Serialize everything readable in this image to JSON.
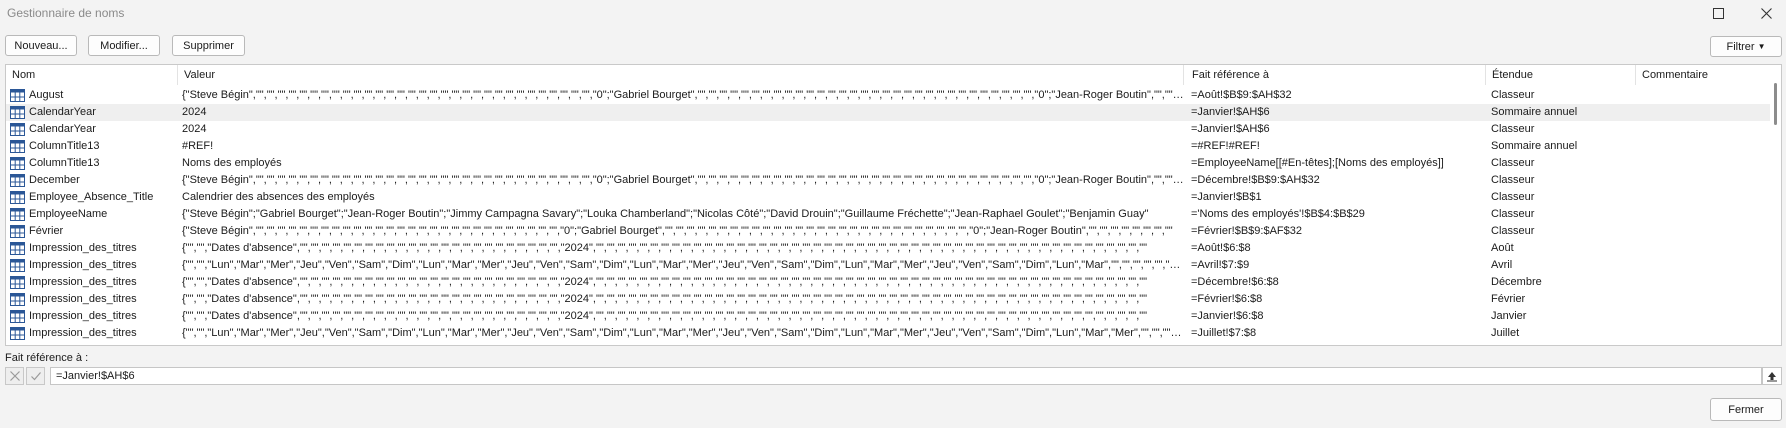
{
  "window": {
    "title": "Gestionnaire de noms"
  },
  "toolbar": {
    "new_label": "Nouveau...",
    "edit_label": "Modifier...",
    "delete_label": "Supprimer",
    "filter_label": "Filtrer"
  },
  "table": {
    "headers": {
      "name": "Nom",
      "value": "Valeur",
      "refers_to": "Fait référence à",
      "scope": "Étendue",
      "comment": "Commentaire"
    },
    "rows": [
      {
        "name": "August",
        "value": "{\"Steve Bégin\",\"\",\"\",\"\",\"\",\"\",\"\",\"\",\"\",\"\",\"\",\"\",\"\",\"\",\"\",\"\",\"\",\"\",\"\",\"\",\"\",\"\",\"\",\"\",\"\",\"\",\"\",\"\",\"\",\"\",\"\",\"\",\"0\";\"Gabriel Bourget\",\"\",\"\",\"\",\"\",\"\",\"\",\"\",\"\",\"\",\"\",\"\",\"\",\"\",\"\",\"\",\"\",\"\",\"\",\"\",\"\",\"\",\"\",\"\",\"\",\"\",\"\",\"\",\"\",\"\",\"\",\"\",\"0\";\"Jean-Roger Boutin\",\"\",\"\",\"\",\"\",\"\",\"\",\"\"",
        "refers_to": "=Août!$B$9:$AH$32",
        "scope": "Classeur",
        "comment": ""
      },
      {
        "name": "CalendarYear",
        "value": "2024",
        "refers_to": "=Janvier!$AH$6",
        "scope": "Sommaire annuel",
        "comment": ""
      },
      {
        "name": "CalendarYear",
        "value": "2024",
        "refers_to": "=Janvier!$AH$6",
        "scope": "Classeur",
        "comment": ""
      },
      {
        "name": "ColumnTitle13",
        "value": "#REF!",
        "refers_to": "=#REF!#REF!",
        "scope": "Sommaire annuel",
        "comment": ""
      },
      {
        "name": "ColumnTitle13",
        "value": "Noms des employés",
        "refers_to": "=EmployeeName[[#En-têtes];[Noms des employés]]",
        "scope": "Classeur",
        "comment": ""
      },
      {
        "name": "December",
        "value": "{\"Steve Bégin\",\"\",\"\",\"\",\"\",\"\",\"\",\"\",\"\",\"\",\"\",\"\",\"\",\"\",\"\",\"\",\"\",\"\",\"\",\"\",\"\",\"\",\"\",\"\",\"\",\"\",\"\",\"\",\"\",\"\",\"\",\"\",\"0\";\"Gabriel Bourget\",\"\",\"\",\"\",\"\",\"\",\"\",\"\",\"\",\"\",\"\",\"\",\"\",\"\",\"\",\"\",\"\",\"\",\"\",\"\",\"\",\"\",\"\",\"\",\"\",\"\",\"\",\"\",\"\",\"\",\"\",\"\",\"0\";\"Jean-Roger Boutin\",\"\",\"\",\"\",\"\",\"\",\"\",\"\"",
        "refers_to": "=Décembre!$B$9:$AH$32",
        "scope": "Classeur",
        "comment": ""
      },
      {
        "name": "Employee_Absence_Title",
        "value": "Calendrier des absences des employés",
        "refers_to": "=Janvier!$B$1",
        "scope": "Classeur",
        "comment": ""
      },
      {
        "name": "EmployeeName",
        "value": "{\"Steve Bégin\";\"Gabriel Bourget\";\"Jean-Roger Boutin\";\"Jimmy Campagna Savary\";\"Louka Chamberland\";\"Nicolas Côté\";\"David Drouin\";\"Guillaume Fréchette\";\"Jean-Raphael Goulet\";\"Benjamin Guay\"",
        "refers_to": "='Noms des employés'!$B$4:$B$29",
        "scope": "Classeur",
        "comment": ""
      },
      {
        "name": "Février",
        "value": "{\"Steve Bégin\",\"\",\"\",\"\",\"\",\"\",\"\",\"\",\"\",\"\",\"\",\"\",\"\",\"\",\"\",\"\",\"\",\"\",\"\",\"\",\"\",\"\",\"\",\"\",\"\",\"\",\"\",\"\",\"\",\"0\";\"Gabriel Bourget\",\"\",\"\",\"\",\"\",\"\",\"\",\"\",\"\",\"\",\"\",\"\",\"\",\"\",\"\",\"\",\"\",\"\",\"\",\"\",\"\",\"\",\"\",\"\",\"\",\"\",\"\",\"\",\"\",\"0\";\"Jean-Roger Boutin\",\"\",\"\",\"\",\"\",\"\",\"\",\"\",\"\"",
        "refers_to": "=Février!$B$9:$AF$32",
        "scope": "Classeur",
        "comment": ""
      },
      {
        "name": "Impression_des_titres",
        "value": "{\"\",\"\",\"Dates d'absence\",\"\",\"\",\"\",\"\",\"\",\"\",\"\",\"\",\"\",\"\",\"\",\"\",\"\",\"\",\"\",\"\",\"\",\"\",\"\",\"\",\"\",\"\",\"\",\"\",\"2024\",\"\",\"\",\"\",\"\",\"\",\"\",\"\",\"\",\"\",\"\",\"\",\"\",\"\",\"\",\"\",\"\",\"\",\"\",\"\",\"\",\"\",\"\",\"\",\"\",\"\",\"\",\"\",\"\",\"\",\"\",\"\",\"\",\"\",\"\",\"\",\"\",\"\",\"\",\"\",\"\",\"\",\"\",\"\",\"\",\"\",\"\",\"\",\"\",\"\",\"\",\"\"",
        "refers_to": "=Août!$6:$8",
        "scope": "Août",
        "comment": ""
      },
      {
        "name": "Impression_des_titres",
        "value": "{\"\",\"\",\"Lun\",\"Mar\",\"Mer\",\"Jeu\",\"Ven\",\"Sam\",\"Dim\",\"Lun\",\"Mar\",\"Mer\",\"Jeu\",\"Ven\",\"Sam\",\"Dim\",\"Lun\",\"Mar\",\"Mer\",\"Jeu\",\"Ven\",\"Sam\",\"Dim\",\"Lun\",\"Mar\",\"Mer\",\"Jeu\",\"Ven\",\"Sam\",\"Dim\",\"Lun\",\"Mar\",\"\",\"\",\"\",\"\",\"\",\"\",\"\"",
        "refers_to": "=Avril!$7:$9",
        "scope": "Avril",
        "comment": ""
      },
      {
        "name": "Impression_des_titres",
        "value": "{\"\",\"\",\"Dates d'absence\",\"\",\"\",\"\",\"\",\"\",\"\",\"\",\"\",\"\",\"\",\"\",\"\",\"\",\"\",\"\",\"\",\"\",\"\",\"\",\"\",\"\",\"\",\"\",\"\",\"2024\",\"\",\"\",\"\",\"\",\"\",\"\",\"\",\"\",\"\",\"\",\"\",\"\",\"\",\"\",\"\",\"\",\"\",\"\",\"\",\"\",\"\",\"\",\"\",\"\",\"\",\"\",\"\",\"\",\"\",\"\",\"\",\"\",\"\",\"\",\"\",\"\",\"\",\"\",\"\",\"\",\"\",\"\",\"\",\"\",\"\",\"\",\"\",\"\",\"\",\"\",\"\"",
        "refers_to": "=Décembre!$6:$8",
        "scope": "Décembre",
        "comment": ""
      },
      {
        "name": "Impression_des_titres",
        "value": "{\"\",\"\",\"Dates d'absence\",\"\",\"\",\"\",\"\",\"\",\"\",\"\",\"\",\"\",\"\",\"\",\"\",\"\",\"\",\"\",\"\",\"\",\"\",\"\",\"\",\"\",\"\",\"\",\"\",\"2024\",\"\",\"\",\"\",\"\",\"\",\"\",\"\",\"\",\"\",\"\",\"\",\"\",\"\",\"\",\"\",\"\",\"\",\"\",\"\",\"\",\"\",\"\",\"\",\"\",\"\",\"\",\"\",\"\",\"\",\"\",\"\",\"\",\"\",\"\",\"\",\"\",\"\",\"\",\"\",\"\",\"\",\"\",\"\",\"\",\"\",\"\",\"\",\"\",\"\",\"\",\"\"",
        "refers_to": "=Février!$6:$8",
        "scope": "Février",
        "comment": ""
      },
      {
        "name": "Impression_des_titres",
        "value": "{\"\",\"\",\"Dates d'absence\",\"\",\"\",\"\",\"\",\"\",\"\",\"\",\"\",\"\",\"\",\"\",\"\",\"\",\"\",\"\",\"\",\"\",\"\",\"\",\"\",\"\",\"\",\"\",\"\",\"2024\",\"\",\"\",\"\",\"\",\"\",\"\",\"\",\"\",\"\",\"\",\"\",\"\",\"\",\"\",\"\",\"\",\"\",\"\",\"\",\"\",\"\",\"\",\"\",\"\",\"\",\"\",\"\",\"\",\"\",\"\",\"\",\"\",\"\",\"\",\"\",\"\",\"\",\"\",\"\",\"\",\"\",\"\",\"\",\"\",\"\",\"\",\"\",\"\",\"\",\"\",\"\"",
        "refers_to": "=Janvier!$6:$8",
        "scope": "Janvier",
        "comment": ""
      },
      {
        "name": "Impression_des_titres",
        "value": "{\"\",\"\",\"Lun\",\"Mar\",\"Mer\",\"Jeu\",\"Ven\",\"Sam\",\"Dim\",\"Lun\",\"Mar\",\"Mer\",\"Jeu\",\"Ven\",\"Sam\",\"Dim\",\"Lun\",\"Mar\",\"Mer\",\"Jeu\",\"Ven\",\"Sam\",\"Dim\",\"Lun\",\"Mar\",\"Mer\",\"Jeu\",\"Ven\",\"Sam\",\"Dim\",\"Lun\",\"Mar\",\"Mer\",\"\",\"\",\"\",\"\",\"\",\"\"",
        "refers_to": "=Juillet!$7:$8",
        "scope": "Juillet",
        "comment": ""
      }
    ]
  },
  "reference": {
    "label": "Fait référence à :",
    "value": "=Janvier!$AH$6"
  },
  "footer": {
    "close_label": "Fermer"
  },
  "colors": {
    "background": "#f3f3f3",
    "list_bg": "#ffffff",
    "selected_row": "#efefef",
    "name_icon": "#2b5797"
  },
  "icons": {
    "maximize": "maximize-icon",
    "close": "close-icon",
    "filter_caret": "caret-down-icon",
    "name_type": "table-grid-icon",
    "cancel_edit": "cancel-x-icon",
    "confirm_edit": "checkmark-icon",
    "collapse_dialog": "collapse-arrow-icon"
  }
}
